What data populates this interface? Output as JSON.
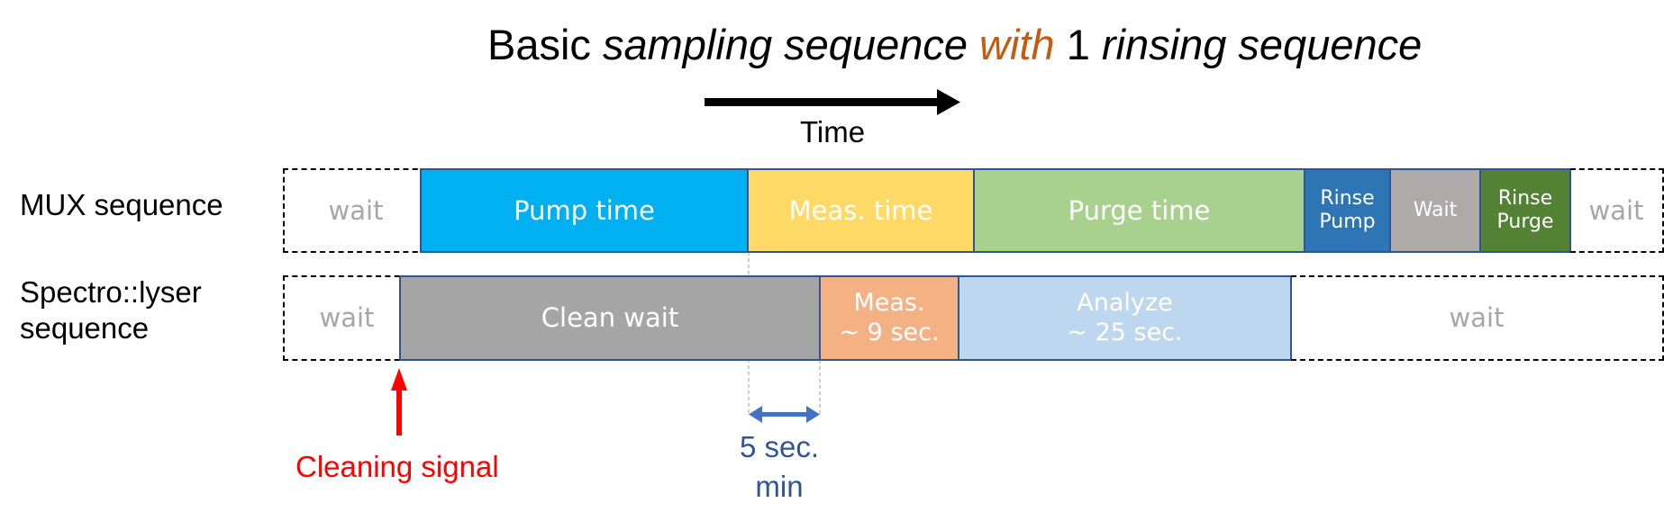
{
  "title": {
    "part1": "Basic ",
    "part2": "sampling sequence ",
    "part3": "with",
    "part4": " 1 ",
    "part5": "rinsing sequence",
    "accent_color": "#c55a11"
  },
  "time_axis": {
    "label": "Time",
    "arrow_icon": "right-arrow"
  },
  "rows": [
    {
      "label": "MUX sequence",
      "blocks": [
        {
          "label": "wait",
          "style": "dashed",
          "color": "transparent"
        },
        {
          "label": "Pump time",
          "style": "solid",
          "color": "#00b0f0"
        },
        {
          "label": "Meas. time",
          "style": "solid",
          "color": "#ffd966"
        },
        {
          "label": "Purge time",
          "style": "solid",
          "color": "#a9d18e"
        },
        {
          "label": "Rinse Pump",
          "style": "solid",
          "color": "#2e75b6"
        },
        {
          "label": "Wait",
          "style": "solid",
          "color": "#aeaaaa"
        },
        {
          "label": "Rinse Purge",
          "style": "solid",
          "color": "#548235"
        },
        {
          "label": "wait",
          "style": "dashed",
          "color": "transparent"
        }
      ]
    },
    {
      "label_line1": "Spectro::lyser",
      "label_line2": "sequence",
      "blocks": [
        {
          "label": "wait",
          "style": "dashed",
          "color": "transparent"
        },
        {
          "label": "Clean wait",
          "style": "solid",
          "color": "#a5a5a5"
        },
        {
          "label_line1": "Meas.",
          "label_line2": "~ 9 sec.",
          "style": "solid",
          "color": "#f4b183"
        },
        {
          "label_line1": "Analyze",
          "label_line2": "~ 25 sec.",
          "style": "solid",
          "color": "#bdd7ee"
        },
        {
          "label": "wait",
          "style": "dashed",
          "color": "transparent"
        }
      ]
    }
  ],
  "annotations": {
    "cleaning_signal": {
      "label": "Cleaning signal",
      "color": "#ff0000",
      "icon": "up-arrow"
    },
    "min_gap": {
      "line1": "5 sec.",
      "line2": "min",
      "color": "#2f5597",
      "arrow_color": "#4472c4",
      "icon": "double-headed-arrow"
    }
  }
}
